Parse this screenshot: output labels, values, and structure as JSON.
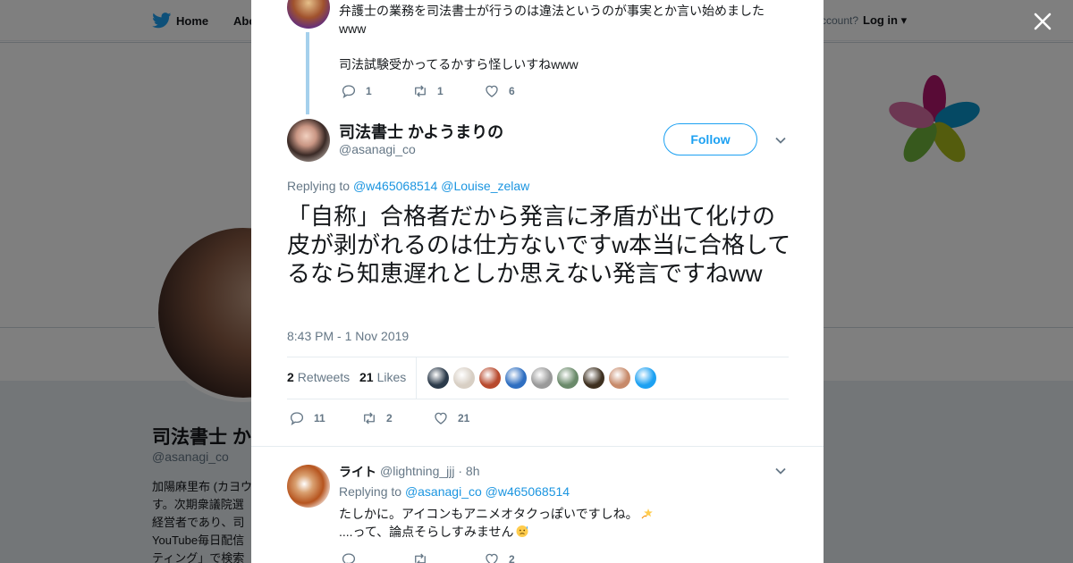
{
  "background": {
    "nav": {
      "home_label": "Home",
      "about_label": "Abo",
      "account_prompt": "ccount?",
      "login_label": "Log in"
    },
    "profile": {
      "name": "司法書士 か",
      "handle": "@asanagi_co",
      "bio_lines": [
        "加陽麻里布 (カヨウ",
        "す。次期衆議院選",
        "経営者であり、司",
        "YouTube毎日配信",
        "ティング」で検索"
      ]
    }
  },
  "modal": {
    "close_icon": "close-icon",
    "parent_tweet": {
      "lines": [
        "弁護士の業務を司法書士が行うのは違法というのが事実とか言い始めました",
        "www",
        "司法試験受かってるかすら怪しいすねwww"
      ],
      "replies": "1",
      "retweets": "1",
      "likes": "6"
    },
    "main_tweet": {
      "name": "司法書士 かようまりの",
      "handle": "@asanagi_co",
      "follow_label": "Follow",
      "replying_prefix": "Replying to",
      "replying_to": [
        "@w465068514",
        "@Louise_zelaw"
      ],
      "text": "「自称」合格者だから発言に矛盾が出て化けの皮が剥がれるのは仕方ないですw本当に合格してるなら知恵遅れとしか思えない発言ですねww",
      "timestamp": "8:43 PM - 1 Nov 2019",
      "retweet_count": "2",
      "retweet_label": "Retweets",
      "like_count": "21",
      "like_label": "Likes",
      "liker_colors": [
        "#2b3a4a",
        "#d8cfc4",
        "#b84a2e",
        "#2f6fc1",
        "#9a9a9a",
        "#6a8a6a",
        "#3e3020",
        "#c78a6a",
        "#1da1f2"
      ],
      "actions": {
        "replies": "11",
        "retweets": "2",
        "likes": "21"
      }
    },
    "reply": {
      "name": "ライト",
      "handle": "@lightning_jjj · 8h",
      "replying_prefix": "Replying to",
      "replying_to": [
        "@asanagi_co",
        "@w465068514"
      ],
      "line1": "たしかに。アイコンもアニメオタクっぽいですしね。",
      "line2": "....って、論点そらしすみません",
      "likes": "2"
    }
  },
  "colors": {
    "accent": "#1da1f2",
    "link": "#1b95e0",
    "muted": "#657786",
    "text": "#14171a"
  }
}
